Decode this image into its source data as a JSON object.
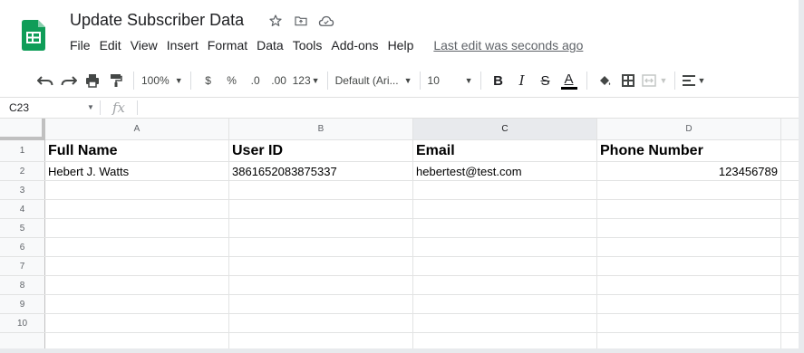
{
  "document": {
    "title": "Update Subscriber Data",
    "last_edit": "Last edit was seconds ago"
  },
  "menu": [
    "File",
    "Edit",
    "View",
    "Insert",
    "Format",
    "Data",
    "Tools",
    "Add-ons",
    "Help"
  ],
  "toolbar": {
    "zoom": "100%",
    "currency": "$",
    "percent": "%",
    "decrease_decimal": ".0",
    "increase_decimal": ".00",
    "more_formats": "123",
    "font": "Default (Ari...",
    "font_size": "10",
    "bold": "B",
    "italic": "I",
    "strikethrough": "S",
    "text_color": "A"
  },
  "formula_bar": {
    "cell_ref": "C23",
    "fx": "fx",
    "value": ""
  },
  "sheet": {
    "columns": [
      "A",
      "B",
      "C",
      "D"
    ],
    "selected_column": "C",
    "rows": [
      {
        "num": "1",
        "cells": [
          "Full Name",
          "User ID",
          "Email",
          "Phone Number"
        ]
      },
      {
        "num": "2",
        "cells": [
          "Hebert J. Watts",
          "3861652083875337",
          "hebertest@test.com",
          "123456789"
        ]
      },
      {
        "num": "3",
        "cells": [
          "",
          "",
          "",
          ""
        ]
      },
      {
        "num": "4",
        "cells": [
          "",
          "",
          "",
          ""
        ]
      },
      {
        "num": "5",
        "cells": [
          "",
          "",
          "",
          ""
        ]
      },
      {
        "num": "6",
        "cells": [
          "",
          "",
          "",
          ""
        ]
      },
      {
        "num": "7",
        "cells": [
          "",
          "",
          "",
          ""
        ]
      },
      {
        "num": "8",
        "cells": [
          "",
          "",
          "",
          ""
        ]
      },
      {
        "num": "9",
        "cells": [
          "",
          "",
          "",
          ""
        ]
      },
      {
        "num": "10",
        "cells": [
          "",
          "",
          "",
          ""
        ]
      }
    ]
  },
  "colors": {
    "sheets_green": "#0f9d58",
    "grid_line": "#e2e3e3",
    "header_bg": "#f8f9fa",
    "selected_header_bg": "#e8eaed"
  }
}
